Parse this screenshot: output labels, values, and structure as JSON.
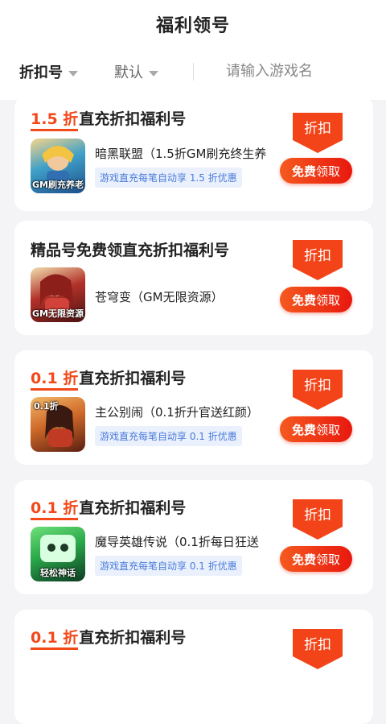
{
  "header": {
    "title": "福利领号"
  },
  "filter": {
    "sort_label": "折扣号",
    "default_label": "默认",
    "search_placeholder": "请输入游戏名"
  },
  "cards": [
    {
      "discount": "1.5 折",
      "title_rest": "直充折扣福利号",
      "game_name": "暗黑联盟（1.5折GM刷充终生养",
      "icon_text": "GM刷充养老",
      "desc": "游戏直充每笔自动享 1.5 折优惠",
      "badge": "折扣",
      "claim_bold": "免费",
      "claim_rest": "领取"
    },
    {
      "discount": "",
      "title_rest": "精品号免费领直充折扣福利号",
      "game_name": "苍穹变（GM无限资源）",
      "icon_text": "GM无限资源",
      "desc": "",
      "badge": "折扣",
      "claim_bold": "免费",
      "claim_rest": "领取"
    },
    {
      "discount": "0.1 折",
      "title_rest": "直充折扣福利号",
      "game_name": "主公别闹（0.1折升官送红颜）",
      "icon_text": "0.1折",
      "desc": "游戏直充每笔自动享 0.1 折优惠",
      "badge": "折扣",
      "claim_bold": "免费",
      "claim_rest": "领取"
    },
    {
      "discount": "0.1 折",
      "title_rest": "直充折扣福利号",
      "game_name": "魔导英雄传说（0.1折每日狂送",
      "icon_text": "轻松神话",
      "desc": "游戏直充每笔自动享 0.1 折优惠",
      "badge": "折扣",
      "claim_bold": "免费",
      "claim_rest": "领取"
    },
    {
      "discount": "0.1 折",
      "title_rest": "直充折扣福利号",
      "game_name": "",
      "icon_text": "",
      "desc": "",
      "badge": "折扣",
      "claim_bold": "",
      "claim_rest": ""
    }
  ]
}
